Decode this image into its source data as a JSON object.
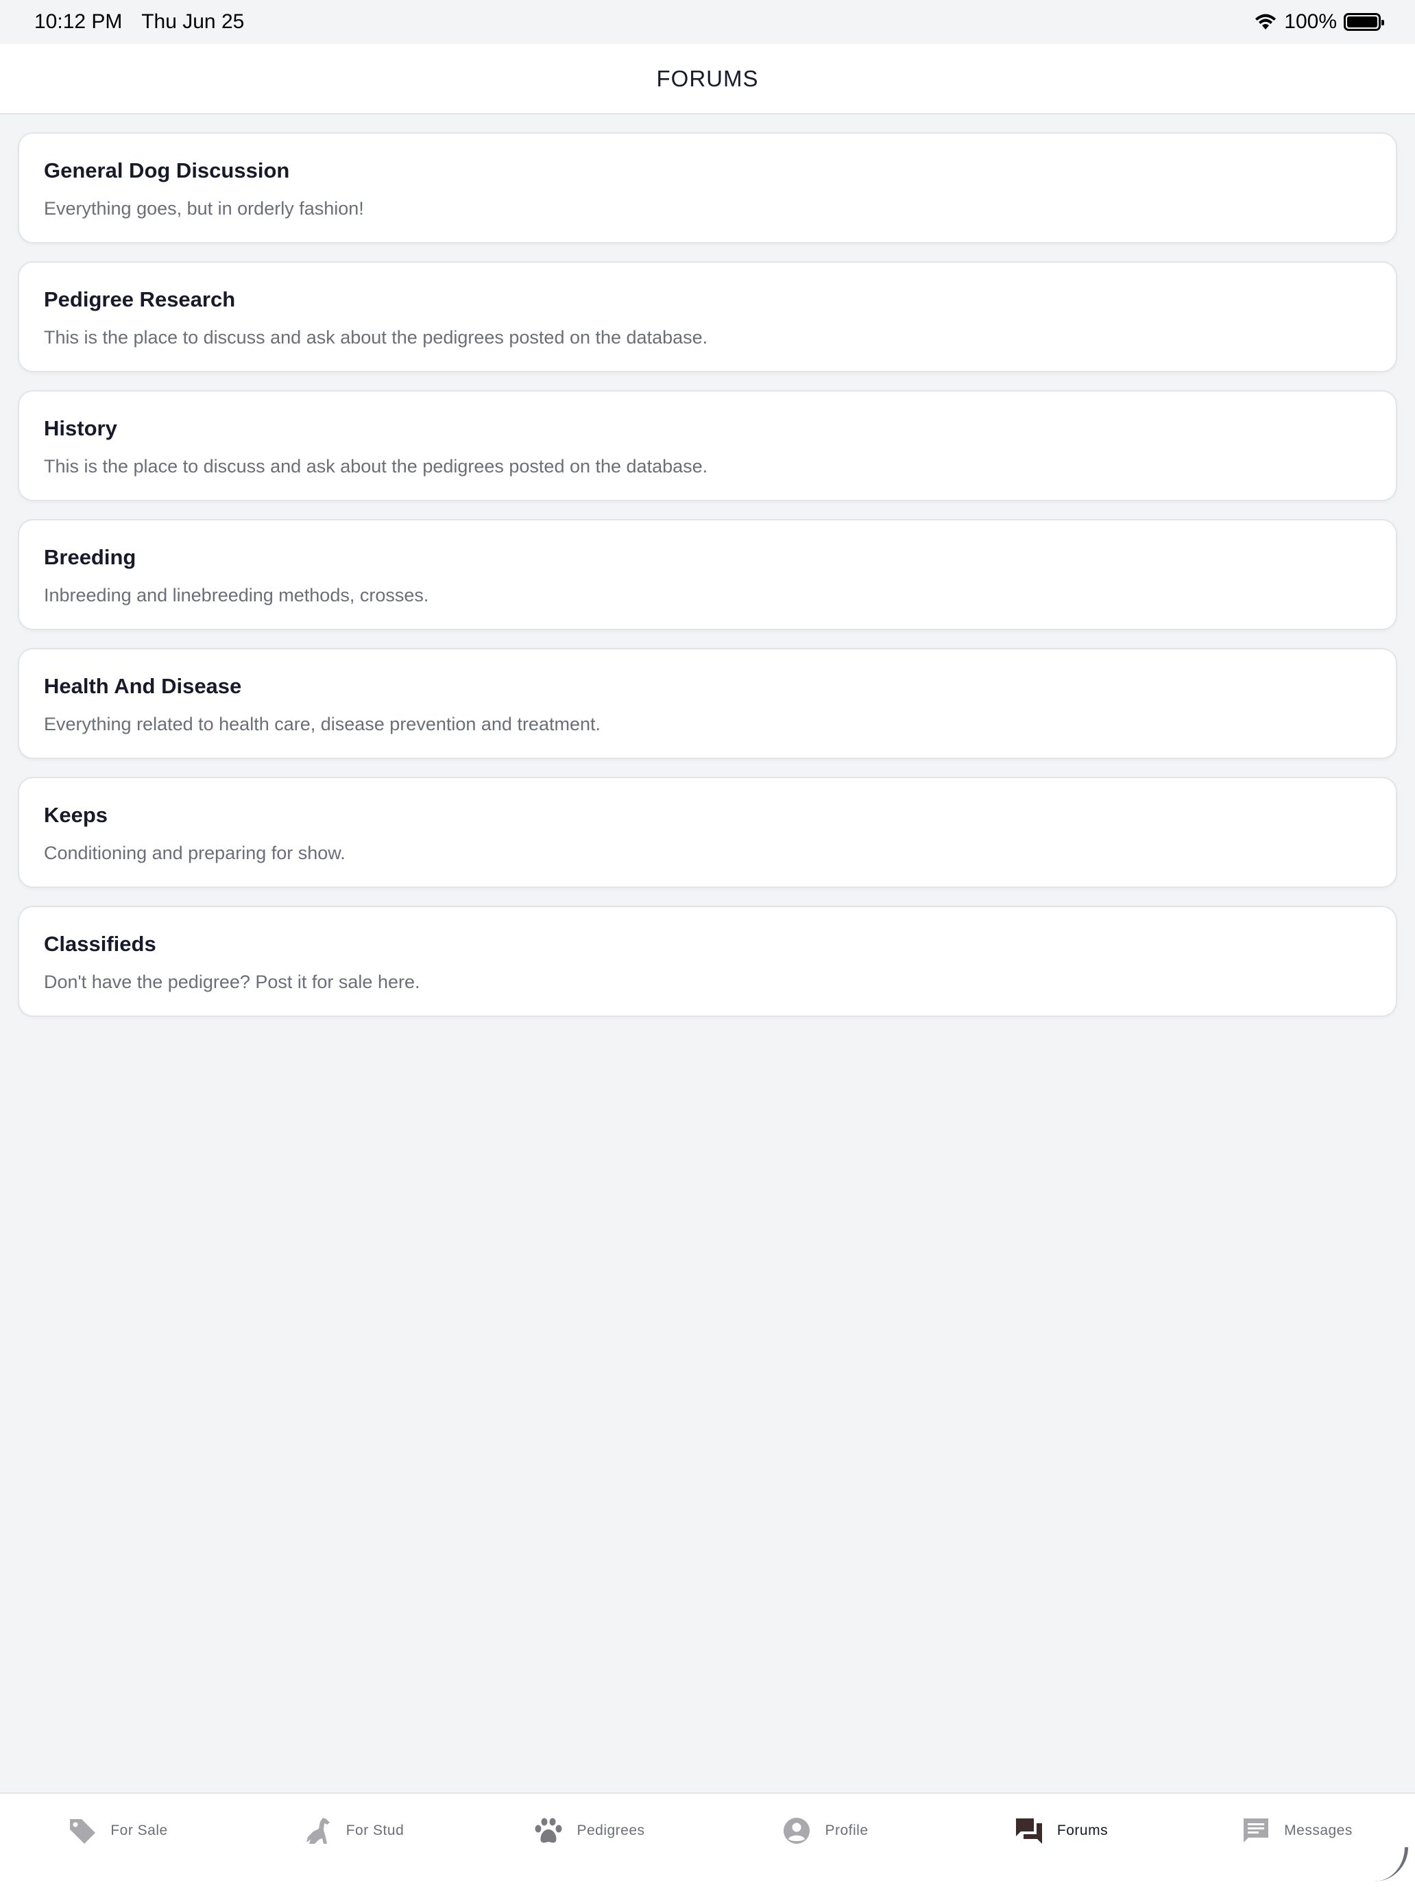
{
  "status_bar": {
    "time": "10:12 PM",
    "date": "Thu Jun 25",
    "battery": "100%"
  },
  "header": {
    "title": "FORUMS"
  },
  "forums": [
    {
      "title": "General Dog Discussion",
      "description": "Everything goes, but in orderly fashion!"
    },
    {
      "title": "Pedigree Research",
      "description": "This is the place to discuss and ask about the pedigrees posted on the database."
    },
    {
      "title": "History",
      "description": "This is the place to discuss and ask about the pedigrees posted on the database."
    },
    {
      "title": "Breeding",
      "description": "Inbreeding and linebreeding methods, crosses."
    },
    {
      "title": "Health And Disease",
      "description": "Everything related to health care, disease prevention and treatment."
    },
    {
      "title": "Keeps",
      "description": "Conditioning and preparing for show."
    },
    {
      "title": "Classifieds",
      "description": "Don't have the pedigree? Post it for sale here."
    }
  ],
  "tabs": [
    {
      "label": "For Sale",
      "icon": "tag-icon"
    },
    {
      "label": "For Stud",
      "icon": "dog-icon"
    },
    {
      "label": "Pedigrees",
      "icon": "paw-icon"
    },
    {
      "label": "Profile",
      "icon": "user-circle-icon"
    },
    {
      "label": "Forums",
      "icon": "forum-icon",
      "active": true
    },
    {
      "label": "Messages",
      "icon": "message-icon"
    }
  ],
  "colors": {
    "accent": "#3d2b2b",
    "inactive_icon": "#a9a9ad",
    "background": "#f3f4f6"
  }
}
